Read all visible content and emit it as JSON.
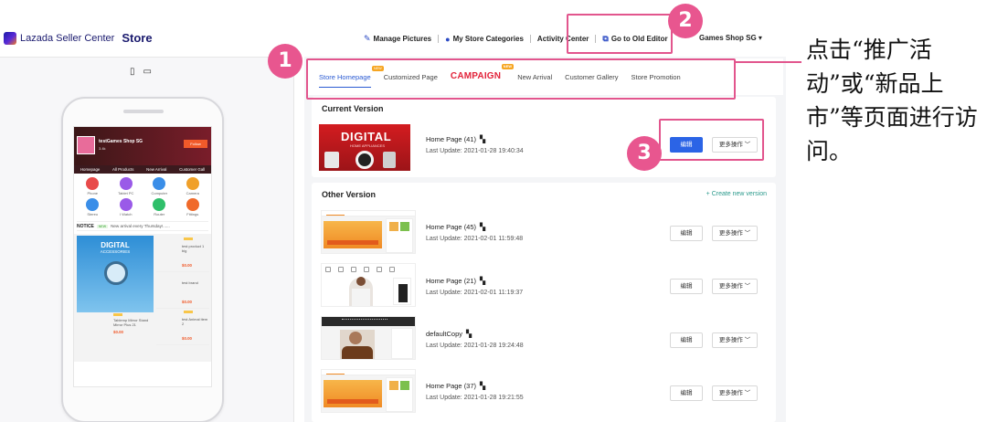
{
  "header": {
    "brand": "Lazada Seller Center",
    "section": "Store",
    "tools": [
      {
        "label": "Manage Pictures",
        "icon": "brush-icon"
      },
      {
        "label": "My Store Categories",
        "icon": "folder-icon"
      },
      {
        "label": "Activity Center",
        "icon": ""
      },
      {
        "label": "Go to Old Editor",
        "icon": "external-link-icon"
      }
    ],
    "shop_name": "Games Shop SG"
  },
  "preview": {
    "shop_name": "testGames Shop SG",
    "shop_sub": "3.4k",
    "follow_label": "Follow",
    "nav_tabs": [
      "Homepage",
      "All Products",
      "New Arrival",
      "Customer Gall"
    ],
    "categories": [
      {
        "label": "Phone",
        "color": "#e84a4a"
      },
      {
        "label": "Tablet PC",
        "color": "#9a5ae8"
      },
      {
        "label": "Computer",
        "color": "#3a8ee8"
      },
      {
        "label": "Camera",
        "color": "#f0a02a"
      },
      {
        "label": "Stereo",
        "color": "#3a8ee8"
      },
      {
        "label": "I Watch",
        "color": "#9a5ae8"
      },
      {
        "label": "Router",
        "color": "#2fbf6a"
      },
      {
        "label": "Fittings",
        "color": "#f06a2a"
      }
    ],
    "notice": {
      "title": "NOTICE",
      "tag": "NEW",
      "text": "New arrival every Thursday!......"
    },
    "digital": {
      "title": "DIGITAL",
      "subtitle": "ACCESSORIES"
    },
    "right_products": [
      {
        "name": "test product 1 big",
        "price": "$0.00"
      },
      {
        "name": "test brand",
        "price": "$0.00"
      }
    ],
    "left_products": [
      {
        "name": "Tablemp Mirror Stand Mirror Plus 21",
        "price": "$0.00"
      }
    ],
    "right_products_2": [
      {
        "name": "test Animal item 2",
        "price": "$0.00"
      }
    ]
  },
  "tabs": [
    {
      "label": "Store Homepage",
      "active": true,
      "badge": "NEW"
    },
    {
      "label": "Customized Page",
      "active": false,
      "badge": ""
    },
    {
      "label": "CAMPAIGN",
      "active": false,
      "badge": "NEW"
    },
    {
      "label": "New Arrival",
      "active": false,
      "badge": ""
    },
    {
      "label": "Customer Gallery",
      "active": false,
      "badge": ""
    },
    {
      "label": "Store Promotion",
      "active": false,
      "badge": ""
    }
  ],
  "current_version": {
    "title": "Current Version",
    "banner_title": "DIGITAL",
    "banner_sub": "HOME APPLIANCES",
    "name": "Home Page (41)",
    "updated": "Last Update: 2021-01-28 19:40:34",
    "edit_label": "编辑",
    "more_label": "更多操作"
  },
  "other_versions": {
    "title": "Other Version",
    "create_label": "+ Create new version",
    "edit_label": "编辑",
    "more_label": "更多操作",
    "rows": [
      {
        "name": "Home Page (45)",
        "updated": "Last Update: 2021-02-01 11:59:48"
      },
      {
        "name": "Home Page (21)",
        "updated": "Last Update: 2021-02-01 11:19:37"
      },
      {
        "name": "defaultCopy",
        "updated": "Last Update: 2021-01-28 19:24:48"
      },
      {
        "name": "Home Page (37)",
        "updated": "Last Update: 2021-01-28 19:21:55"
      }
    ]
  },
  "annotations": {
    "markers": [
      "1",
      "2",
      "3"
    ],
    "note": "点击“推广活动”或“新品上市”等页面进行访问。",
    "color": "#e2558d"
  }
}
